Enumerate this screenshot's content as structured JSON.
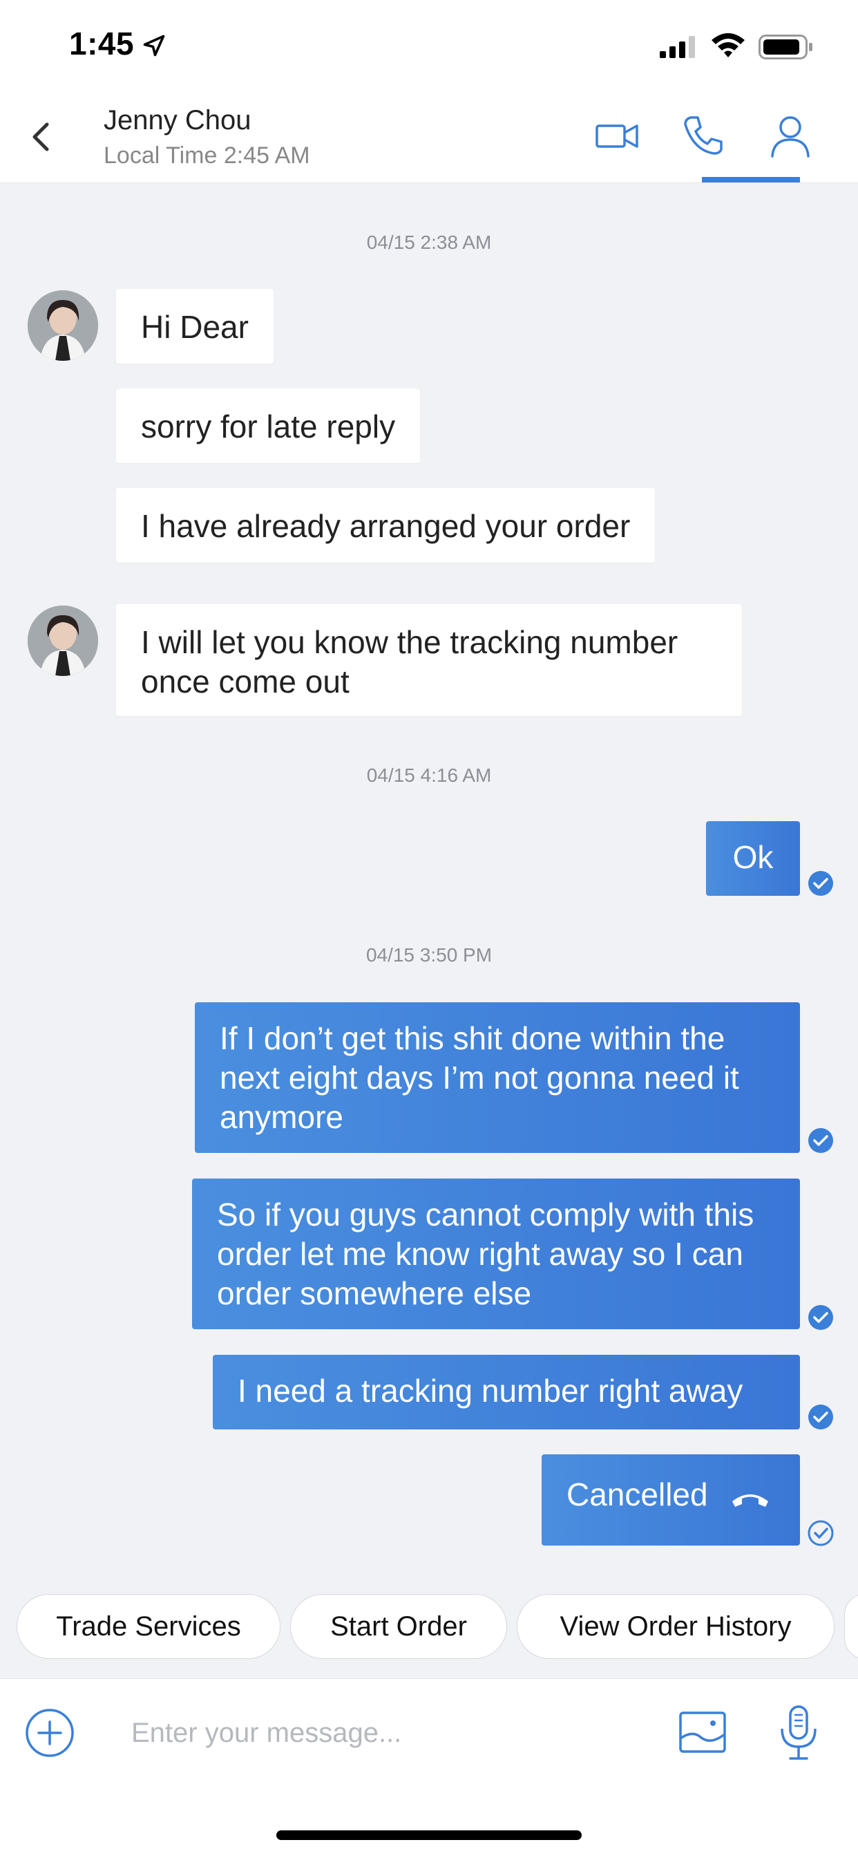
{
  "status_bar": {
    "time": "1:45"
  },
  "header": {
    "contact_name": "Jenny Chou",
    "local_time": "Local Time 2:45 AM",
    "icons": [
      "back-chevron-icon",
      "video-call-icon",
      "phone-icon",
      "profile-icon"
    ]
  },
  "messages": {
    "timestamp_1": "04/15 2:38 AM",
    "incoming_1": "Hi Dear",
    "incoming_2": "sorry for late reply",
    "incoming_3": "I have already arranged your order",
    "incoming_4": "I will let you know the tracking number once come out",
    "timestamp_2": "04/15 4:16 AM",
    "outgoing_1": "Ok",
    "timestamp_3": "04/15 3:50 PM",
    "outgoing_2": "If I don’t get this shit done within the next eight days I’m not gonna need it anymore",
    "outgoing_3": "So if you guys cannot comply with this order let me know right away so I can order somewhere else",
    "outgoing_4": "I need a tracking number right away",
    "outgoing_5": "Cancelled"
  },
  "quick_replies": [
    "Trade Services",
    "Start Order",
    "View Order History"
  ],
  "composer": {
    "placeholder": "Enter your message..."
  },
  "colors": {
    "accent": "#3a7fd8",
    "outgoing_bubble": "#3f80da",
    "background": "#f1f2f6"
  }
}
